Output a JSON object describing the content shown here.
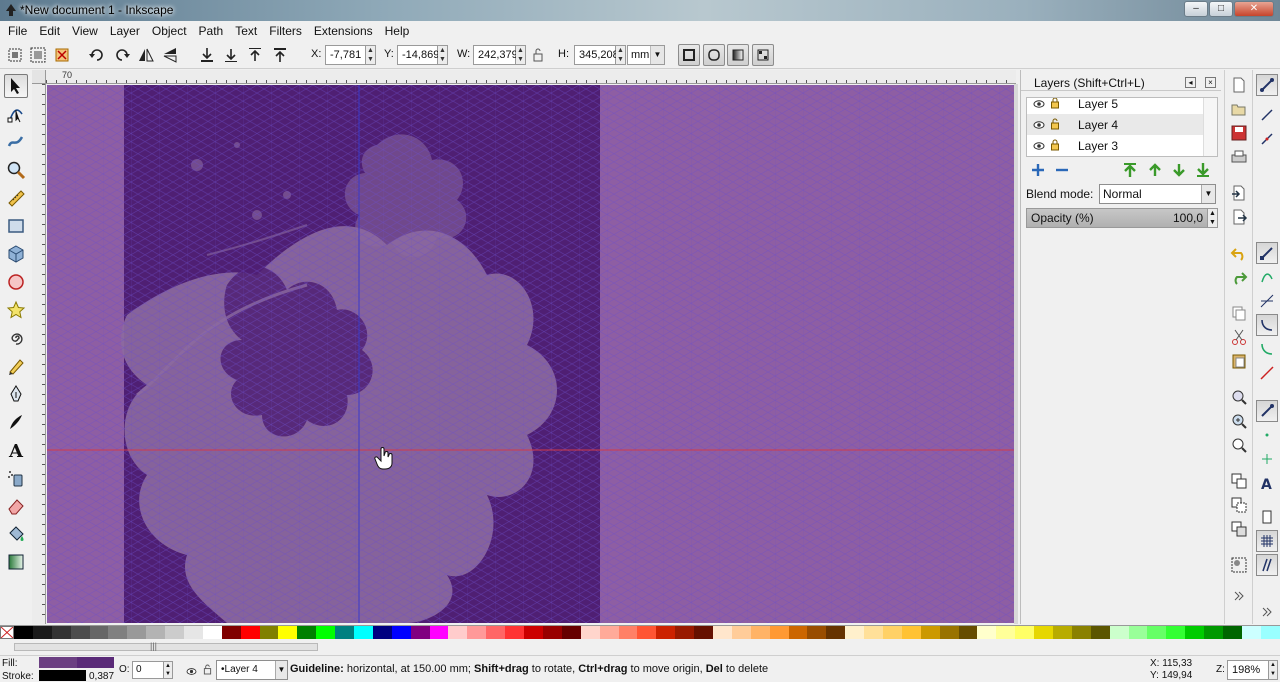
{
  "window": {
    "title": "*New document 1 - Inkscape",
    "minimize": "–",
    "maximize": "□",
    "close": "✕"
  },
  "menu": [
    "File",
    "Edit",
    "View",
    "Layer",
    "Object",
    "Path",
    "Text",
    "Filters",
    "Extensions",
    "Help"
  ],
  "controls": {
    "x_label": "X:",
    "x_value": "-7,781",
    "y_label": "Y:",
    "y_value": "-14,869",
    "w_label": "W:",
    "w_value": "242,379",
    "h_label": "H:",
    "h_value": "345,208",
    "unit": "mm"
  },
  "ruler_labels": {
    "h_first": "70",
    "v_marks": [
      "2",
      "1",
      "1",
      "1",
      "1",
      "1",
      "1",
      "1",
      "1",
      "1",
      "1",
      "1"
    ]
  },
  "layers_dialog": {
    "title": "Layers (Shift+Ctrl+L)",
    "layers": [
      {
        "name": "Layer 5",
        "selected": false
      },
      {
        "name": "Layer 4",
        "selected": true
      },
      {
        "name": "Layer 3",
        "selected": false
      }
    ],
    "blend_label": "Blend mode:",
    "blend_value": "Normal",
    "opacity_label": "Opacity (%)",
    "opacity_value": "100,0"
  },
  "status": {
    "fill_label": "Fill:",
    "stroke_label": "Stroke:",
    "fill_color": "#6b3f82",
    "fill_color2": "#5a2a78",
    "stroke_color": "#000000",
    "stroke_width": "0,387",
    "opacity_label": "O:",
    "opacity_value": "0",
    "current_layer": "•Layer 4",
    "message_bold1": "Guideline:",
    "message_text1": " horizontal, at 150.00 mm; ",
    "message_bold2": "Shift+drag",
    "message_text2": " to rotate, ",
    "message_bold3": "Ctrl+drag",
    "message_text3": " to move origin, ",
    "message_bold4": "Del",
    "message_text4": " to delete",
    "x_label": "X:",
    "x_value": "115,33",
    "y_label": "Y:",
    "y_value": "149,94",
    "zoom_label": "Z:",
    "zoom_value": "198%"
  },
  "colors": {
    "canvas_page": "#8e5ea3",
    "photo_dark": "#4f1f73",
    "photo_light": "#8c6aa0",
    "grid_line": "#6b4fc9",
    "guide_horizontal": "#d13a4a",
    "guide_vertical": "#3a3ac8"
  },
  "palette": [
    "#000000",
    "#1a1a1a",
    "#333333",
    "#4d4d4d",
    "#666666",
    "#808080",
    "#999999",
    "#b3b3b3",
    "#cccccc",
    "#e6e6e6",
    "#ffffff",
    "#800000",
    "#ff0000",
    "#808000",
    "#ffff00",
    "#008000",
    "#00ff00",
    "#008080",
    "#00ffff",
    "#000080",
    "#0000ff",
    "#800080",
    "#ff00ff",
    "#ffcccc",
    "#ff9999",
    "#ff6666",
    "#ff3333",
    "#cc0000",
    "#990000",
    "#660000",
    "#ffd5cc",
    "#ffaa99",
    "#ff8066",
    "#ff5533",
    "#cc2200",
    "#991a00",
    "#661100",
    "#ffe6cc",
    "#ffcc99",
    "#ffb366",
    "#ff9933",
    "#cc6600",
    "#994d00",
    "#663300",
    "#fff0cc",
    "#ffe099",
    "#ffd166",
    "#ffc233",
    "#cc9900",
    "#997300",
    "#664d00",
    "#ffffcc",
    "#ffff99",
    "#ffff66",
    "#e6d700",
    "#b8ac00",
    "#8a8100",
    "#5c5600",
    "#ccffcc",
    "#99ff99",
    "#66ff66",
    "#33ff33",
    "#00cc00",
    "#009900",
    "#006600",
    "#ccffff",
    "#99ffff"
  ]
}
